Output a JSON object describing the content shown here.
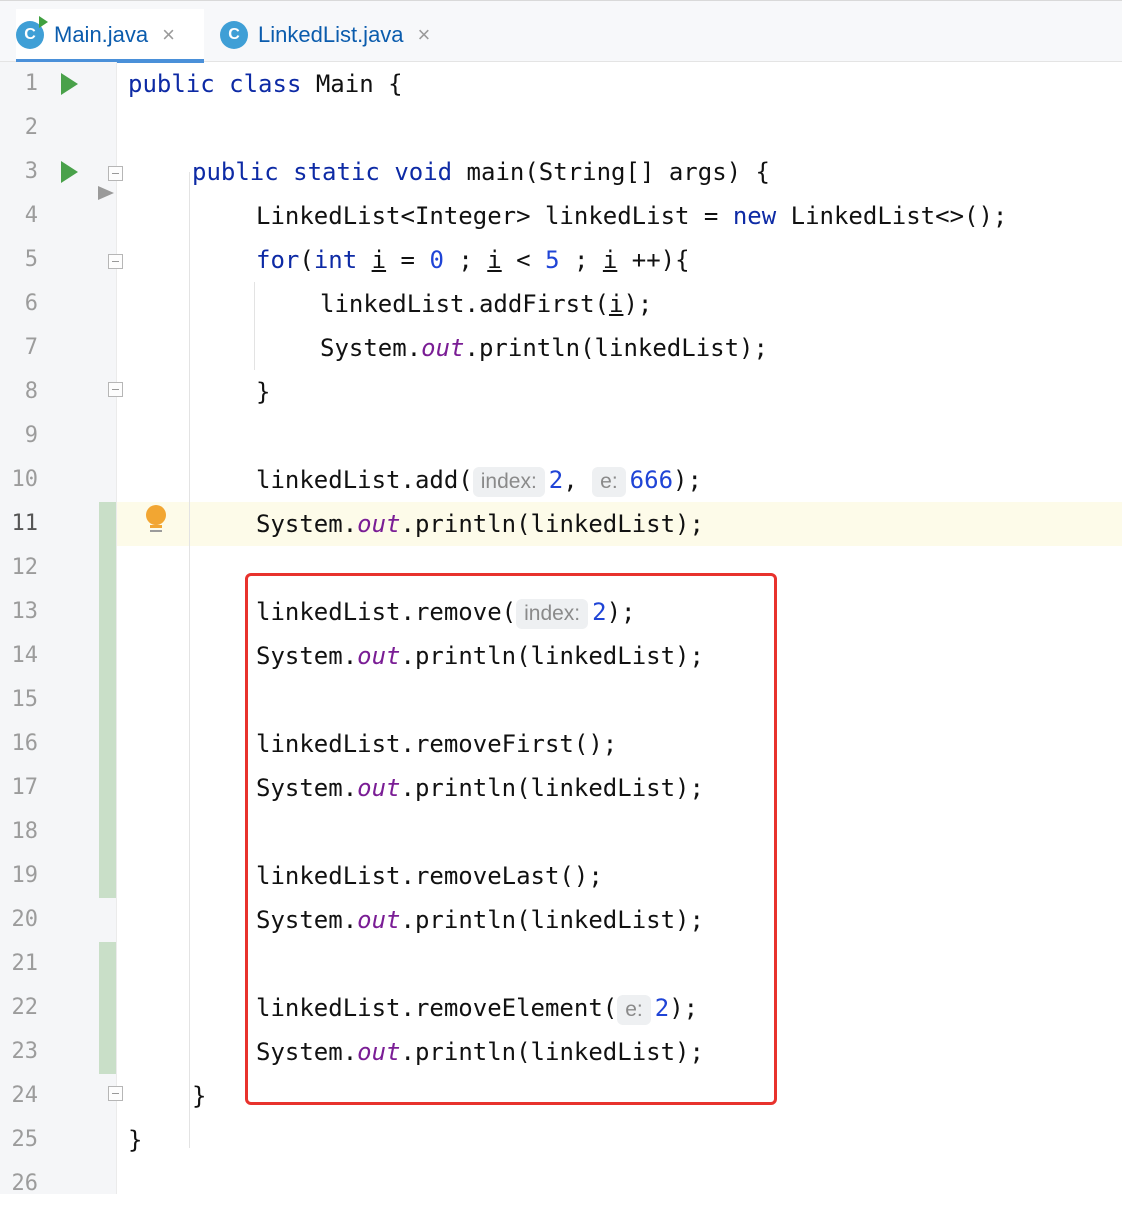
{
  "tabs": [
    {
      "label": "Main.java",
      "icon": "java-class-run-icon",
      "active": true
    },
    {
      "label": "LinkedList.java",
      "icon": "java-class-icon",
      "active": false
    }
  ],
  "tab_icon_letter": "C",
  "tab_close_glyph": "×",
  "line_numbers": [
    "1",
    "2",
    "3",
    "4",
    "5",
    "6",
    "7",
    "8",
    "9",
    "10",
    "11",
    "12",
    "13",
    "14",
    "15",
    "16",
    "17",
    "18",
    "19",
    "20",
    "21",
    "22",
    "23",
    "24",
    "25",
    "26"
  ],
  "current_line": 11,
  "code": {
    "l1": {
      "kw1": "public",
      "kw2": "class",
      "rest": " Main {"
    },
    "l3": {
      "kw1": "public",
      "kw2": "static",
      "kw3": "void",
      "rest": " main(String[] args) {"
    },
    "l4": {
      "a": "LinkedList<Integer> linkedList = ",
      "kw": "new",
      "b": " LinkedList<>();"
    },
    "l5": {
      "kw1": "for",
      "p1": "(",
      "kw2": "int",
      "sp": " ",
      "v1": "i",
      "eq": " = ",
      "n1": "0",
      "s1": " ; ",
      "v2": "i",
      "lt": " < ",
      "n2": "5",
      "s2": " ; ",
      "v3": "i",
      "end": " ++){"
    },
    "l6": {
      "a": "linkedList.addFirst(",
      "v": "i",
      "b": ");"
    },
    "l7": {
      "a": "System.",
      "f": "out",
      "b": ".println(linkedList);"
    },
    "l8": {
      "a": "}"
    },
    "l10": {
      "a": "linkedList.add(",
      "h1": "index:",
      "n1": "2",
      "c": ", ",
      "h2": "e:",
      "n2": "666",
      "b": ");"
    },
    "l11": {
      "a": "System.",
      "f": "out",
      "b": ".println(linkedList);"
    },
    "l13": {
      "a": "linkedList.remove(",
      "h": "index:",
      "n": "2",
      "b": ");"
    },
    "l14": {
      "a": "System.",
      "f": "out",
      "b": ".println(linkedList);"
    },
    "l16": {
      "a": "linkedList.removeFirst();"
    },
    "l17": {
      "a": "System.",
      "f": "out",
      "b": ".println(linkedList);"
    },
    "l19": {
      "a": "linkedList.removeLast();"
    },
    "l20": {
      "a": "System.",
      "f": "out",
      "b": ".println(linkedList);"
    },
    "l22": {
      "a": "linkedList.removeElement(",
      "h": "e:",
      "n": "2",
      "b": ");"
    },
    "l23": {
      "a": "System.",
      "f": "out",
      "b": ".println(linkedList);"
    },
    "l24": {
      "a": "}"
    },
    "l25": {
      "a": "}"
    }
  },
  "colors": {
    "keyword": "#0d2aa5",
    "number": "#1f44d6",
    "static_field": "#7a1d95",
    "highlight_box": "#e8322d",
    "change_marker": "#c9dfc8",
    "current_line_bg": "#fdfbe9"
  }
}
